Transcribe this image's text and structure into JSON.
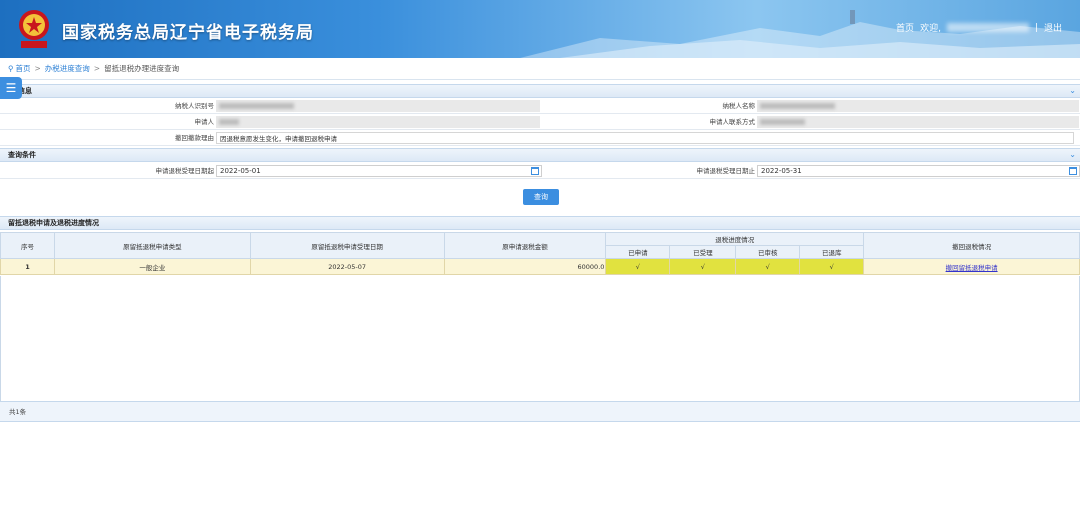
{
  "header": {
    "site_title": "国家税务总局辽宁省电子税务局",
    "home_link": "首页",
    "welcome": "欢迎,",
    "separator": "|",
    "logout": "退出",
    "logo_caption": "中国税务"
  },
  "breadcrumb": {
    "home": "首页",
    "sep1": ">",
    "progress_query": "办税进度查询",
    "sep2": ">",
    "current": "留抵退税办理进度查询"
  },
  "basic_info": {
    "section_title": "信息",
    "taxpayer_id_label": "纳税人识别号",
    "taxpayer_name_label": "纳税人名称",
    "applicant_label": "申请人",
    "applicant_contact_label": "申请人联系方式",
    "withdraw_reason_label": "撤回撤款理由",
    "withdraw_reason_value": "因退税意愿发生变化，申请撤回退税申请"
  },
  "query": {
    "section_title": "查询条件",
    "start_label": "申请退税受理日期起",
    "start_value": "2022-05-01",
    "end_label": "申请退税受理日期止",
    "end_value": "2022-05-31",
    "button": "查询"
  },
  "results": {
    "section_title": "留抵退税申请及退税进度情况",
    "columns": {
      "index": "序号",
      "type": "原留抵退税申请类型",
      "date": "原留抵退税申请受理日期",
      "amount": "原申请退税金额",
      "progress": "退税进度情况",
      "withdraw": "撤回退税情况"
    },
    "progress_columns": [
      "已申请",
      "已受理",
      "已审核",
      "已退库"
    ],
    "rows": [
      {
        "index": "1",
        "type": "一般企业",
        "date": "2022-05-07",
        "amount": "60000.0",
        "progress": [
          "√",
          "√",
          "√",
          "√"
        ],
        "withdraw_link": "撤回留抵退税申请"
      }
    ],
    "total": "共1条"
  },
  "colors": {
    "accent": "#3b8ee0",
    "row_highlight": "#fbf5d6",
    "progress_highlight": "#e1e23f"
  }
}
